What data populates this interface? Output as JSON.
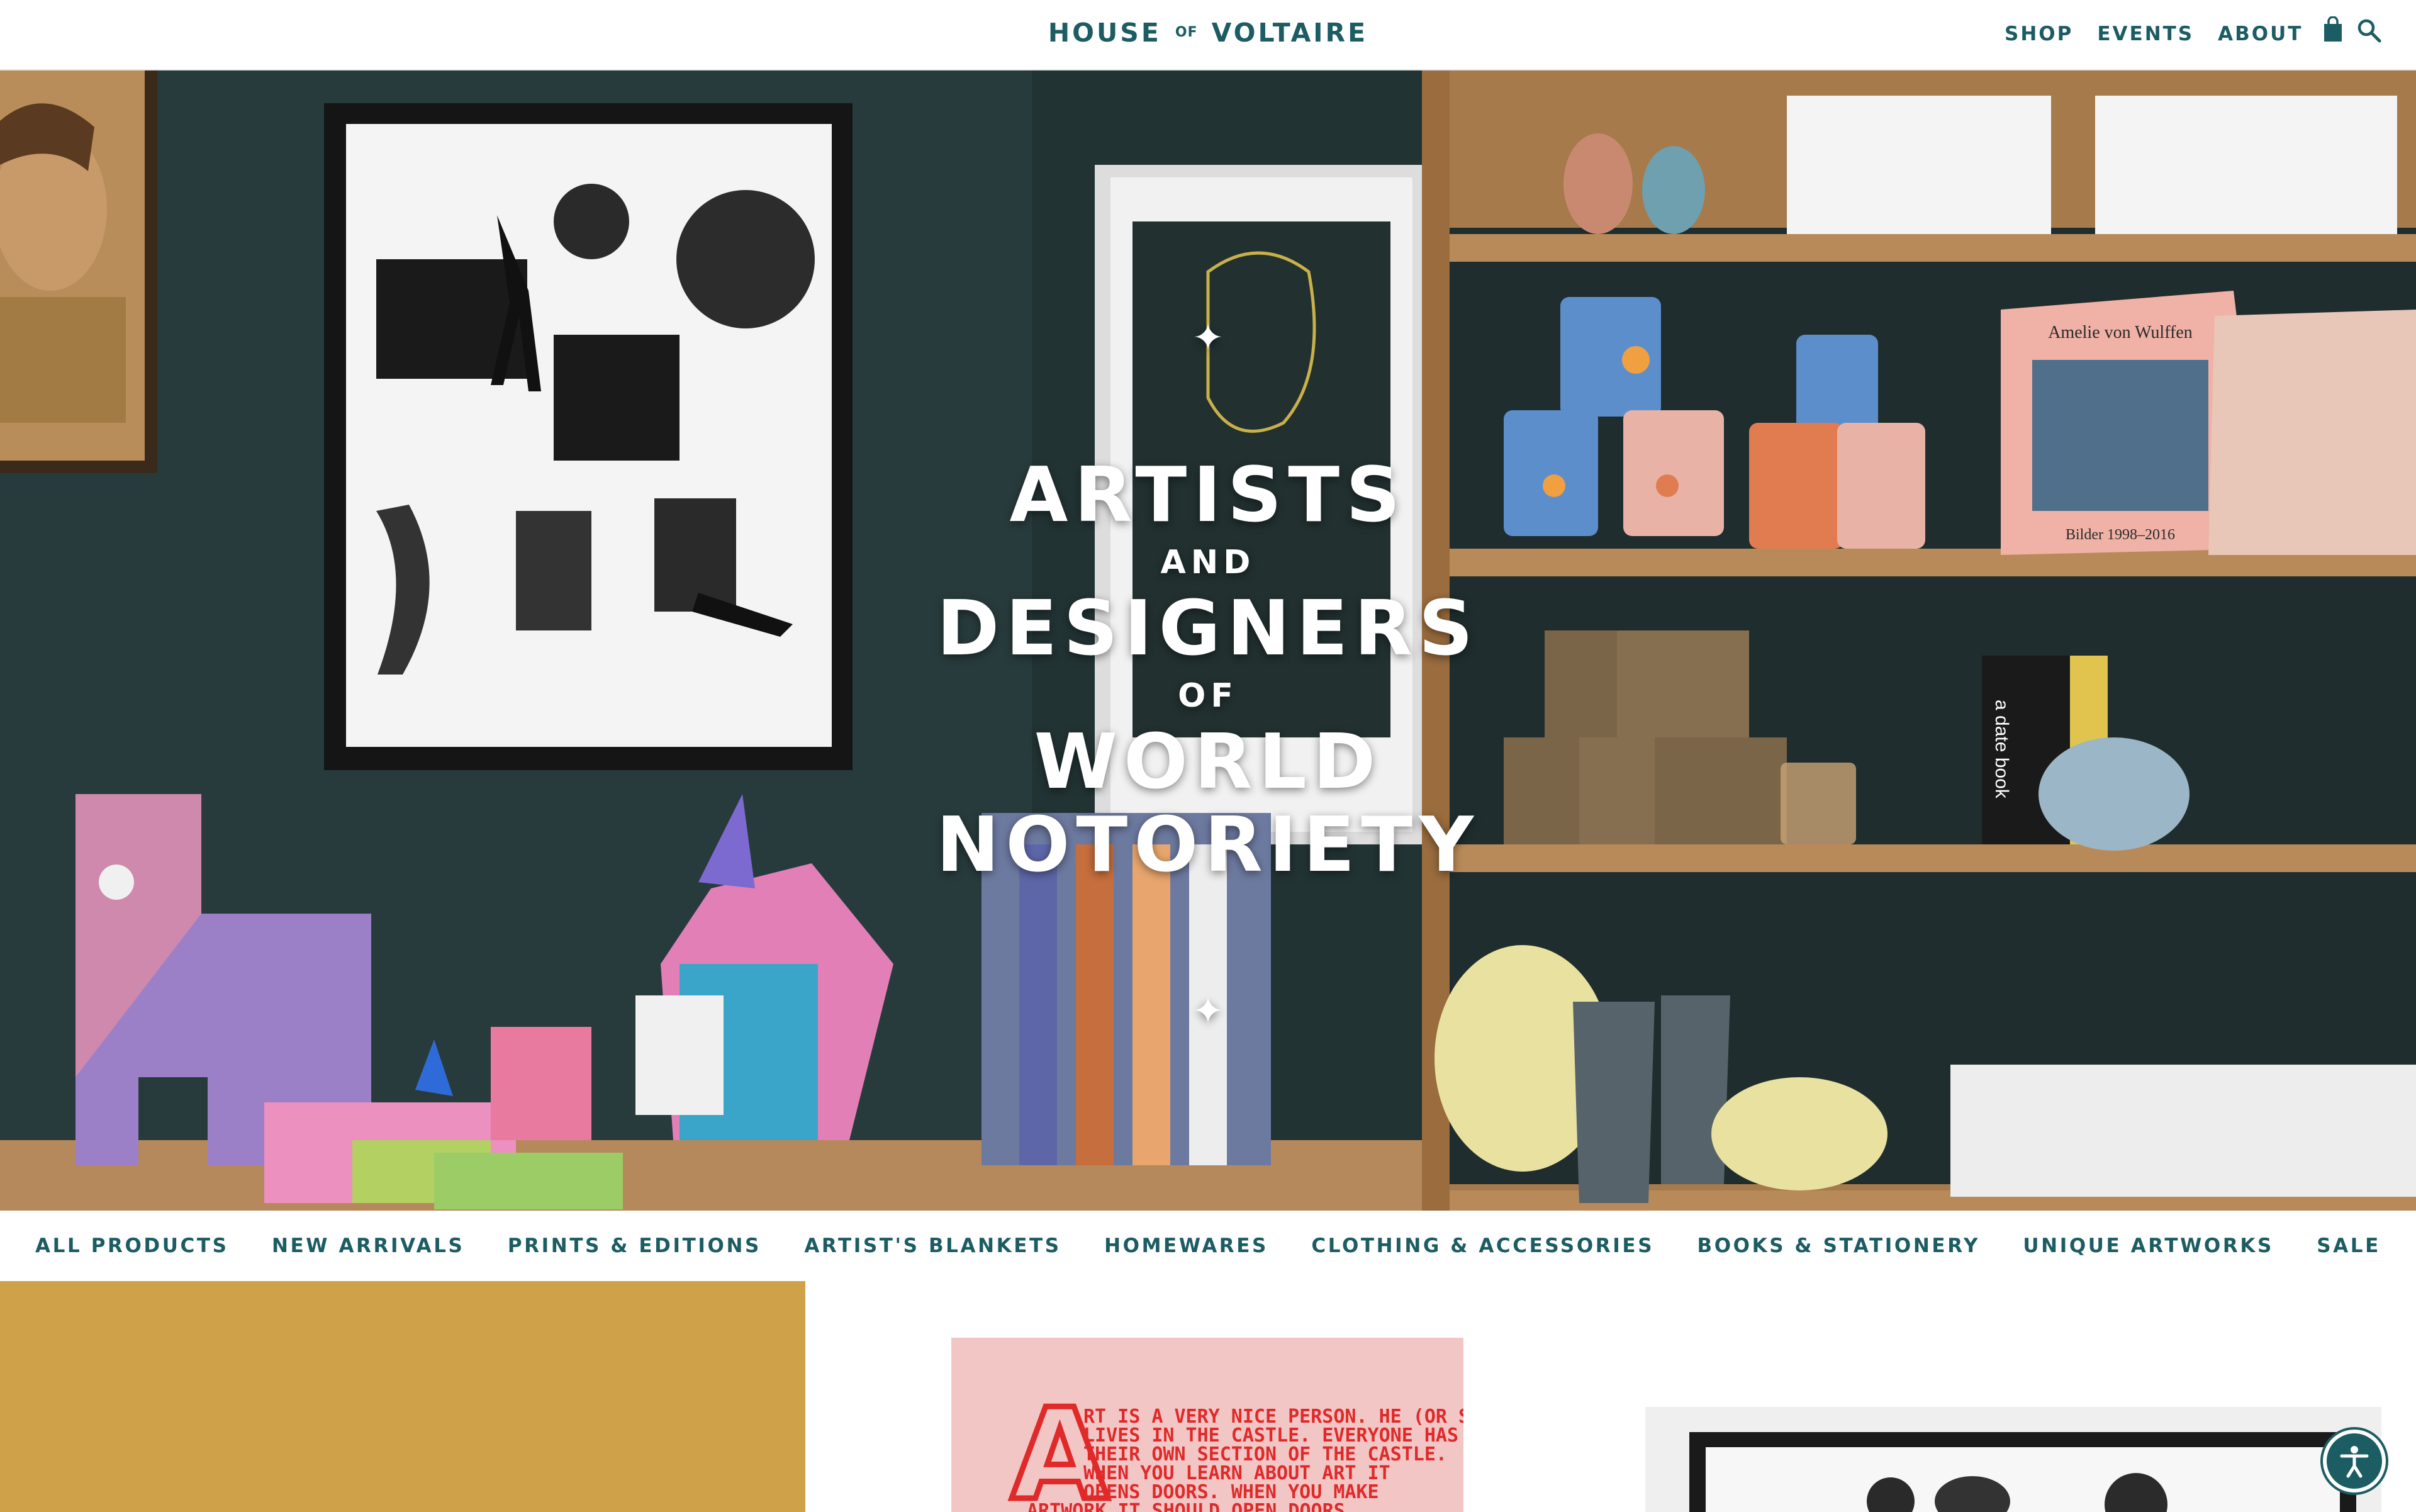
{
  "brand": {
    "left": "HOUSE",
    "mid": "OF",
    "right": "VOLTAIRE"
  },
  "topnav": {
    "shop": "SHOP",
    "events": "EVENTS",
    "about": "ABOUT"
  },
  "header_icons": [
    "shopping-bag-icon",
    "search-icon"
  ],
  "hero": {
    "line1": "ARTISTS",
    "line2": "AND",
    "line3": "DESIGNERS",
    "line4": "OF",
    "line5": "WORLD",
    "line6": "NOTORIETY",
    "sparkle": "✦",
    "book_author": "Amelie von Wulffen",
    "book_subtitle": "Bilder 1998–2016",
    "spine_text": "a date book"
  },
  "categories": [
    "ALL PRODUCTS",
    "NEW ARRIVALS",
    "PRINTS & EDITIONS",
    "ARTIST'S BLANKETS",
    "HOMEWARES",
    "CLOTHING & ACCESSORIES",
    "BOOKS & STATIONERY",
    "UNIQUE ARTWORKS",
    "SALE"
  ],
  "product_text_print": {
    "letter": "A",
    "lines": [
      "RT IS A VERY NICE PERSON. HE (OR SHE)",
      "LIVES IN THE CASTLE. EVERYONE HAS",
      "THEIR OWN SECTION OF THE CASTLE.",
      "WHEN YOU LEARN ABOUT ART IT",
      "OPENS DOORS. WHEN YOU MAKE",
      "ARTWORK IT SHOULD OPEN DOORS"
    ]
  },
  "colors": {
    "brand": "#1c5c63",
    "mustard": "#cfa249",
    "pink": "#f3c6c6",
    "wall": "#283a3b",
    "wood": "#b98a59"
  }
}
